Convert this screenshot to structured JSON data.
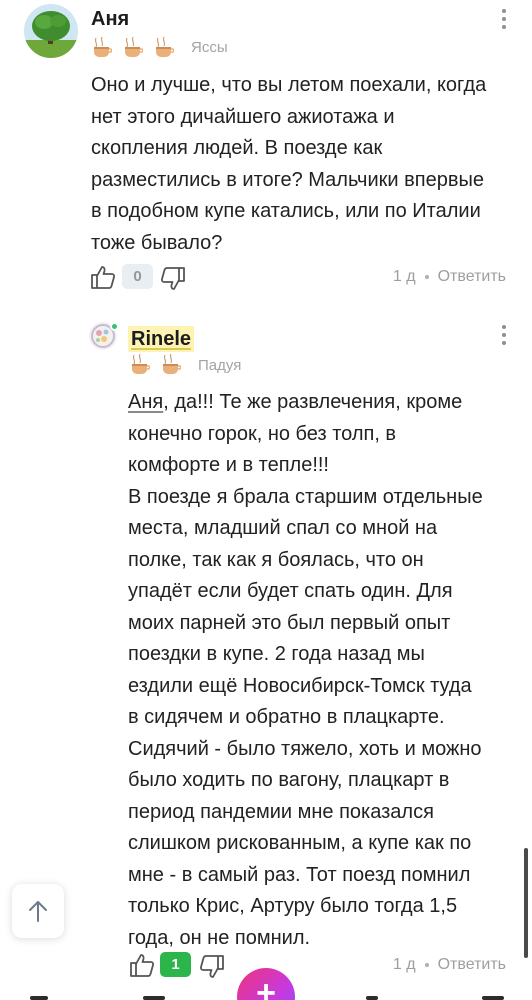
{
  "comments": [
    {
      "author": "Аня",
      "rank": "Яссы",
      "badge_count": 3,
      "text": "Оно и лучше, что вы летом поехали, когда\nнет этого дичайшего ажиотажа и\nскопления людей. В поезде как\nразместились в итоге? Мальчики впервые\nв подобном купе катались, или по Италии\nтоже бывало?",
      "likes": "0",
      "time": "1 д",
      "reply_label": "Ответить"
    },
    {
      "author": "Rinele",
      "rank": "Падуя",
      "badge_count": 2,
      "mention": "Аня",
      "text": ", да!!! Те же развлечения, кроме\nконечно горок, но без толп, в\nкомфорте и в тепле!!!\nВ поезде я брала старшим отдельные\nместа, младший спал со мной на\nполке, так как я боялась, что он\nупадёт если будет спать один. Для\nмоих парней это был первый опыт\nпоездки в купе. 2 года назад мы\nездили ещё Новосибирск-Томск туда\nв сидячем и обратно в плацкарте.\nСидячий - было тяжело, хоть и можно\nбыло ходить по вагону, плацкарт в\nпериод пандемии мне показался\nслишком рискованным, а купе как по\nмне - в самый раз. Тот поезд помнил\nтолько Крис, Артуру было тогда 1,5\nгода, он не помнил.",
      "likes": "1",
      "time": "1 д",
      "reply_label": "Ответить"
    }
  ],
  "fab": {
    "label": "+"
  },
  "colors": {
    "accent_green": "#2bb54b",
    "highlight": "#fdf4b3",
    "muted": "#9e9e9e"
  },
  "icons": {
    "badge": "coffee-cup-icon",
    "like": "thumb-up-icon",
    "dislike": "thumb-down-icon",
    "menu": "more-vertical-icon",
    "scroll_top": "arrow-up-icon"
  }
}
